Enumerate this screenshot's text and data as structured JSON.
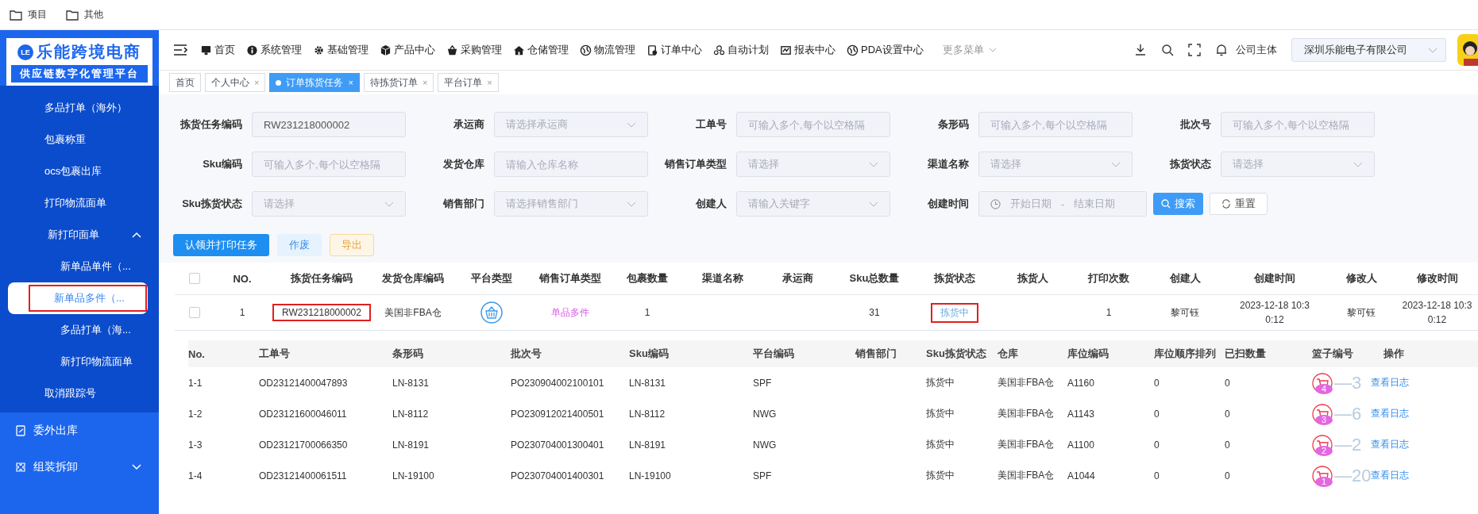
{
  "bookmarks": [
    "项目",
    "其他"
  ],
  "logo": {
    "mark": "LE",
    "title": "乐能跨境电商",
    "subtitle": "供应链数字化管理平台"
  },
  "sidebar": {
    "items": [
      {
        "label": "多品打单（海外）",
        "selected": false,
        "annotated": false
      },
      {
        "label": "包裹称重",
        "selected": false,
        "annotated": false
      },
      {
        "label": "ocs包裹出库",
        "selected": false,
        "annotated": false
      },
      {
        "label": "打印物流面单",
        "selected": false,
        "annotated": false
      },
      {
        "label": "新打印面单",
        "selected": false,
        "annotated": false,
        "expanded": true,
        "children": [
          {
            "label": "新单品单件（...",
            "selected": false,
            "annotated": false
          },
          {
            "label": "新单品多件（...",
            "selected": true,
            "annotated": true
          },
          {
            "label": "多品打单（海...",
            "selected": false,
            "annotated": false
          },
          {
            "label": "新打印物流面单",
            "selected": false,
            "annotated": false
          }
        ]
      },
      {
        "label": "取消跟踪号",
        "selected": false,
        "annotated": false
      }
    ],
    "sections": [
      {
        "label": "委外出库"
      },
      {
        "label": "组装拆卸",
        "expanded": false
      }
    ]
  },
  "nav": {
    "items": [
      {
        "label": "首页"
      },
      {
        "label": "系统管理"
      },
      {
        "label": "基础管理"
      },
      {
        "label": "产品中心"
      },
      {
        "label": "采购管理"
      },
      {
        "label": "仓储管理"
      },
      {
        "label": "物流管理"
      },
      {
        "label": "订单中心"
      },
      {
        "label": "自动计划"
      },
      {
        "label": "报表中心"
      },
      {
        "label": "PDA设置中心"
      }
    ],
    "more": "更多菜单",
    "company_label": "公司主体",
    "company": "深圳乐能电子有限公司"
  },
  "tabs": [
    {
      "label": "首页",
      "selected": false
    },
    {
      "label": "个人中心",
      "selected": false,
      "close": "×"
    },
    {
      "label": "订单拣货任务",
      "selected": true,
      "close": "×"
    },
    {
      "label": "待拣货订单",
      "selected": false,
      "close": "×"
    },
    {
      "label": "平台订单",
      "selected": false,
      "close": "×"
    }
  ],
  "filters": [
    {
      "label": "拣货任务编码",
      "kind": "input",
      "value": "RW231218000002"
    },
    {
      "label": "承运商",
      "kind": "select",
      "placeholder": "请选择承运商"
    },
    {
      "label": "工单号",
      "kind": "input",
      "placeholder": "可输入多个,每个以空格隔"
    },
    {
      "label": "条形码",
      "kind": "input",
      "placeholder": "可输入多个,每个以空格隔"
    },
    {
      "label": "批次号",
      "kind": "input",
      "placeholder": "可输入多个,每个以空格隔"
    },
    {
      "label": "Sku编码",
      "kind": "input",
      "placeholder": "可输入多个,每个以空格隔"
    },
    {
      "label": "发货仓库",
      "kind": "input",
      "placeholder": "请输入仓库名称"
    },
    {
      "label": "销售订单类型",
      "kind": "select",
      "placeholder": "请选择"
    },
    {
      "label": "渠道名称",
      "kind": "select",
      "placeholder": "请选择"
    },
    {
      "label": "拣货状态",
      "kind": "select",
      "placeholder": "请选择"
    },
    {
      "label": "Sku拣货状态",
      "kind": "select",
      "placeholder": "请选择"
    },
    {
      "label": "销售部门",
      "kind": "select",
      "placeholder": "请选择销售部门"
    },
    {
      "label": "创建人",
      "kind": "select",
      "placeholder": "请输入关键字"
    },
    {
      "label": "创建时间",
      "kind": "daterange",
      "start": "开始日期",
      "separator": "-",
      "end": "结束日期"
    }
  ],
  "search_button": "搜索",
  "reset_button": "重置",
  "actions": [
    {
      "label": "认领并打印任务",
      "kind": "primary"
    },
    {
      "label": "作废",
      "kind": "light"
    },
    {
      "label": "导出",
      "kind": "warning"
    }
  ],
  "table": {
    "all_checked": false,
    "columns": [
      "NO.",
      "拣货任务编码",
      "发货仓库编码",
      "平台类型",
      "销售订单类型",
      "包裹数量",
      "渠道名称",
      "承运商",
      "Sku总数量",
      "拣货状态",
      "拣货人",
      "打印次数",
      "创建人",
      "创建时间",
      "修改人",
      "修改时间"
    ],
    "rows": [
      {
        "checked": false,
        "no": "1",
        "task_code": "RW231218000002",
        "task_code_annotated": true,
        "warehouse": "美国非FBA仓",
        "sales_type": "单品多件",
        "packages": "1",
        "sku_total": "31",
        "status": "拣货中",
        "status_annotated": true,
        "print_count": "1",
        "creator": "黎可钰",
        "created": "2023-12-18 10:30:12",
        "modifier": "黎可钰",
        "modified": "2023-12-18 10:30:12"
      }
    ]
  },
  "detail": {
    "columns": [
      "No.",
      "工单号",
      "条形码",
      "批次号",
      "Sku编码",
      "平台编码",
      "销售部门",
      "Sku拣货状态",
      "仓库",
      "库位编码",
      "库位顺序排列",
      "已扫数量",
      "篮子编号",
      "操作"
    ],
    "rows": [
      {
        "no": "1-1",
        "order": "OD23121400047893",
        "barcode": "LN-8131",
        "batch": "PO230904002100101",
        "sku": "LN-8131",
        "platform": "SPF",
        "status": "拣货中",
        "warehouse": "美国非FBA仓",
        "location": "A1160",
        "order_seq": "0",
        "scanned": "0",
        "basket_badge": "4",
        "basket_code": "—3",
        "action": "查看日志"
      },
      {
        "no": "1-2",
        "order": "OD23121600046011",
        "barcode": "LN-8112",
        "batch": "PO230912021400501",
        "sku": "LN-8112",
        "platform": "NWG",
        "status": "拣货中",
        "warehouse": "美国非FBA仓",
        "location": "A1143",
        "order_seq": "0",
        "scanned": "0",
        "basket_badge": "3",
        "basket_code": "—6",
        "action": "查看日志"
      },
      {
        "no": "1-3",
        "order": "OD23121700066350",
        "barcode": "LN-8191",
        "batch": "PO230704001300401",
        "sku": "LN-8191",
        "platform": "NWG",
        "status": "拣货中",
        "warehouse": "美国非FBA仓",
        "location": "A1100",
        "order_seq": "0",
        "scanned": "0",
        "basket_badge": "2",
        "basket_code": "—2",
        "action": "查看日志"
      },
      {
        "no": "1-4",
        "order": "OD23121400061511",
        "barcode": "LN-19100",
        "batch": "PO230704001400301",
        "sku": "LN-19100",
        "platform": "SPF",
        "status": "拣货中",
        "warehouse": "美国非FBA仓",
        "location": "A1044",
        "order_seq": "0",
        "scanned": "0",
        "basket_badge": "1",
        "basket_code": "—20",
        "action": "查看日志"
      }
    ]
  }
}
